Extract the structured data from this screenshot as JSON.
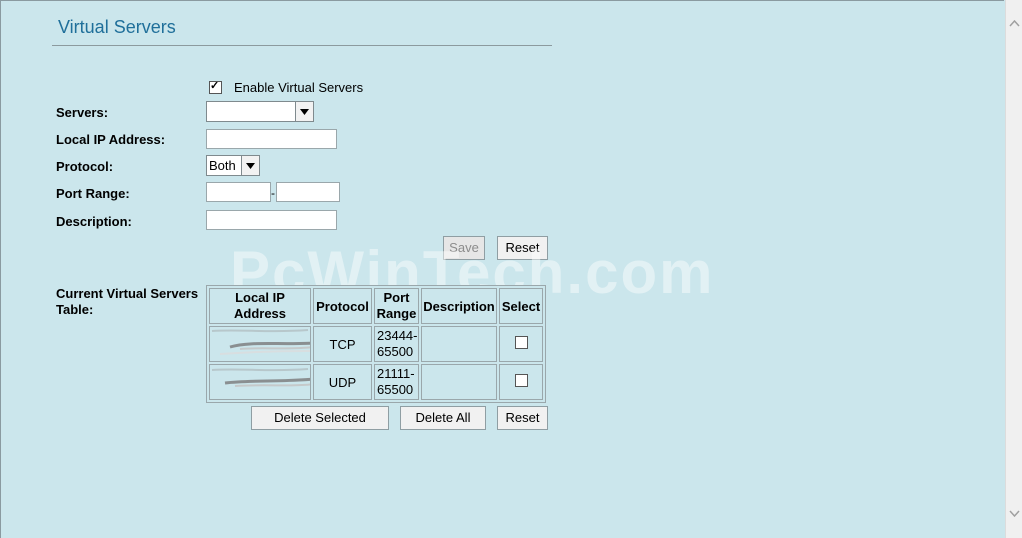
{
  "page": {
    "title": "Virtual Servers"
  },
  "form": {
    "enable_label": "Enable Virtual Servers",
    "enable_checked": true,
    "servers_label": "Servers:",
    "servers_value": "",
    "local_ip_label": "Local IP Address:",
    "local_ip_value": "",
    "protocol_label": "Protocol:",
    "protocol_value": "Both",
    "port_range_label": "Port Range:",
    "port_range_separator": "-",
    "port_from_value": "",
    "port_to_value": "",
    "description_label": "Description:",
    "description_value": "",
    "save_label": "Save",
    "reset_label": "Reset"
  },
  "table": {
    "label": "Current Virtual Servers Table:",
    "headers": [
      "Local IP Address",
      "Protocol",
      "Port Range",
      "Description",
      "Select"
    ],
    "rows": [
      {
        "protocol": "TCP",
        "port_range": "23444-65500",
        "description": ""
      },
      {
        "protocol": "UDP",
        "port_range": "21111-65500",
        "description": ""
      }
    ],
    "delete_selected_label": "Delete Selected",
    "delete_all_label": "Delete All",
    "reset_label": "Reset"
  },
  "watermark": "PcWinTech.com",
  "icons": {
    "scroll_up": "chevron-up-icon",
    "scroll_down": "chevron-down-icon",
    "dropdown": "chevron-down-icon"
  }
}
